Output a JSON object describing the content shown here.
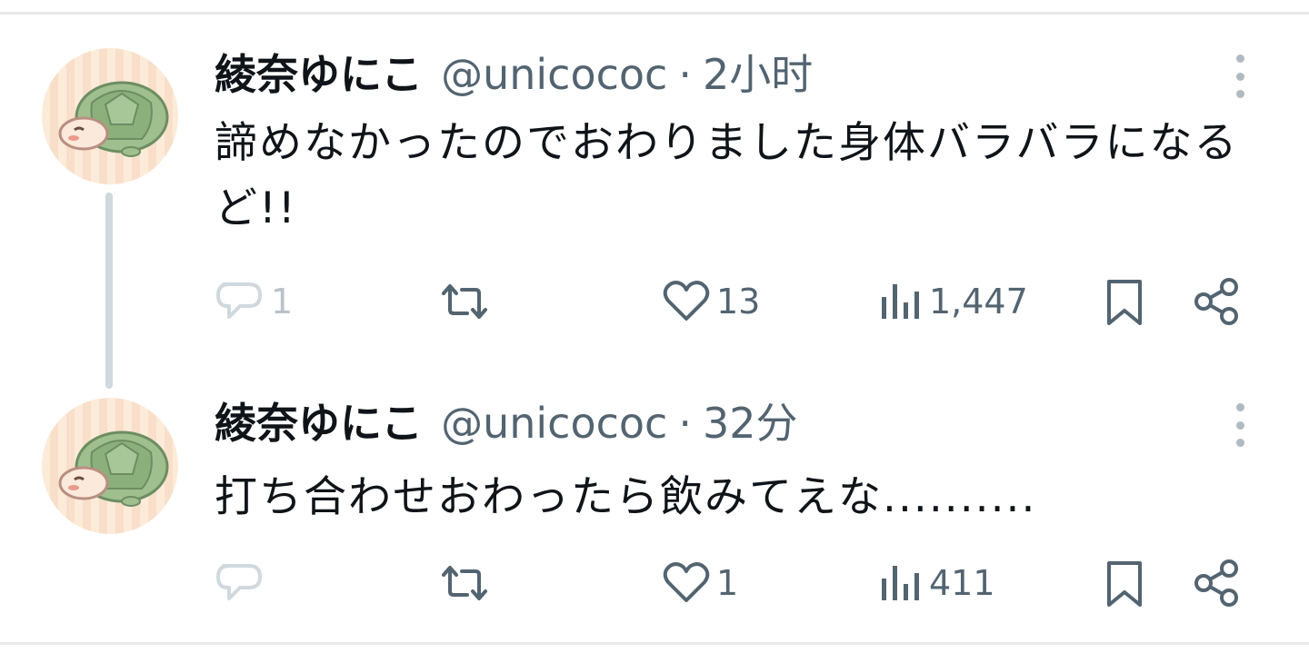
{
  "tweets": [
    {
      "name": "綾奈ゆにこ",
      "handle": "@unicococ",
      "separator": "·",
      "time": "2小时",
      "text": "諦めなかったのでおわりました身体バラバラになるど!!",
      "replies": "1",
      "retweets": "",
      "likes": "13",
      "views": "1,447"
    },
    {
      "name": "綾奈ゆにこ",
      "handle": "@unicococ",
      "separator": "·",
      "time": "32分",
      "text": "打ち合わせおわったら飲みてえな..........",
      "replies": "",
      "retweets": "",
      "likes": "1",
      "views": "411"
    }
  ],
  "icons": [
    "avatar-turtle",
    "more-icon",
    "reply-icon",
    "retweet-icon",
    "like-icon",
    "views-icon",
    "bookmark-icon",
    "share-icon"
  ],
  "colors": {
    "text": "#0f1419",
    "secondary": "#536471",
    "divider": "#e6e8ea",
    "thread": "#cfd9de"
  }
}
